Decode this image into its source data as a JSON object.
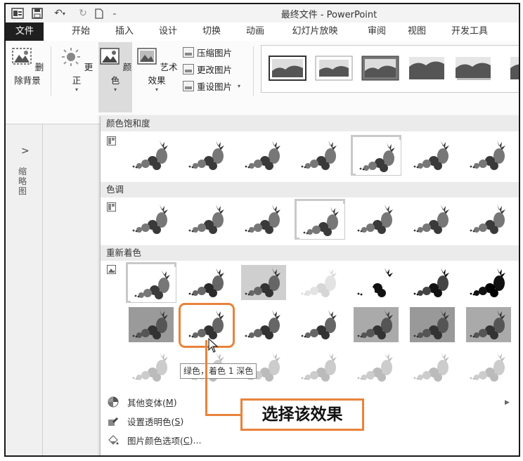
{
  "titlebar": {
    "app_icon": "P",
    "title": "最终文件 - PowerPoint"
  },
  "tabs": [
    "文件",
    "开始",
    "插入",
    "设计",
    "切换",
    "动画",
    "幻灯片放映",
    "审阅",
    "视图",
    "开发工具"
  ],
  "ribbon": {
    "remove_bg": "删除背景",
    "corrections": "更正",
    "color": "颜色",
    "artistic": "艺术效果",
    "compress": "压缩图片",
    "change": "更改图片",
    "reset": "重设图片"
  },
  "left_pane": {
    "chevron": ">",
    "vertical_label": "缩略图"
  },
  "dropdown": {
    "sections": {
      "saturation": "颜色饱和度",
      "tone": "色调",
      "recolor": "重新着色"
    },
    "menu": {
      "more_variants": "其他变体(",
      "more_variants_key": "M",
      "set_transparent": "设置透明色(",
      "set_transparent_key": "S",
      "color_options": "图片颜色选项(",
      "color_options_key": "C",
      "close_paren": ")",
      "ellipsis": ")..."
    },
    "tooltip": "绿色，着色 1 深色"
  },
  "callout": {
    "text": "选择该效果"
  },
  "colors": {
    "accent": "#e8833a",
    "file_tab": "#1f1f1f",
    "section_bg": "#ebebeb"
  }
}
